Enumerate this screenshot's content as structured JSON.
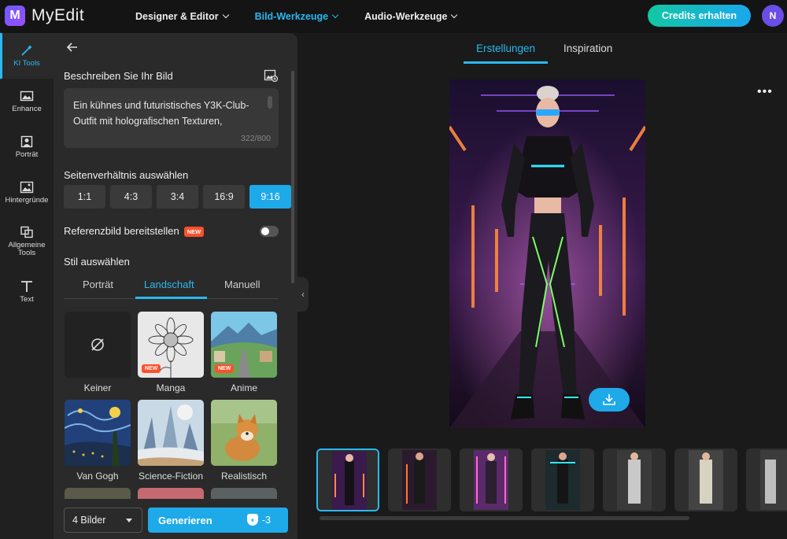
{
  "app": {
    "name": "MyEdit",
    "logo_letter": "M"
  },
  "nav": [
    {
      "label": "Designer & Editor",
      "active": false
    },
    {
      "label": "Bild-Werkzeuge",
      "active": true
    },
    {
      "label": "Audio-Werkzeuge",
      "active": false
    }
  ],
  "header": {
    "credits_label": "Credits erhalten",
    "avatar_initial": "N"
  },
  "rail": [
    {
      "label": "KI Tools",
      "icon": "magic-wand-icon",
      "active": true
    },
    {
      "label": "Enhance",
      "icon": "image-enhance-icon",
      "active": false
    },
    {
      "label": "Porträt",
      "icon": "portrait-icon",
      "active": false
    },
    {
      "label": "Hintergründe",
      "icon": "background-icon",
      "active": false
    },
    {
      "label": "Allgemeine Tools",
      "icon": "tools-icon",
      "active": false
    },
    {
      "label": "Text",
      "icon": "text-icon",
      "active": false
    }
  ],
  "panel": {
    "describe_label": "Beschreiben Sie Ihr Bild",
    "prompt_text": "Ein kühnes und futuristisches Y3K-Club-Outfit mit holografischen Texturen,",
    "prompt_count": "322/800",
    "ratio_label": "Seitenverhältnis auswählen",
    "ratios": [
      "1:1",
      "4:3",
      "3:4",
      "16:9",
      "9:16"
    ],
    "ratio_selected": "9:16",
    "reference_label": "Referenzbild bereitstellen",
    "new_badge": "NEW",
    "style_label": "Stil auswählen",
    "style_tabs": [
      "Porträt",
      "Landschaft",
      "Manuell"
    ],
    "style_tab_active": "Landschaft",
    "styles": [
      {
        "label": "Keiner",
        "new": false
      },
      {
        "label": "Manga",
        "new": true
      },
      {
        "label": "Anime",
        "new": true
      },
      {
        "label": "Van Gogh",
        "new": false
      },
      {
        "label": "Science-Fiction",
        "new": false
      },
      {
        "label": "Realistisch",
        "new": false
      }
    ],
    "count_value": "4 Bilder",
    "generate_label": "Generieren",
    "generate_cost": "-3"
  },
  "main": {
    "tabs": [
      "Erstellungen",
      "Inspiration"
    ],
    "tab_active": "Erstellungen",
    "more_label": "•••"
  },
  "colors": {
    "accent": "#1ea9e8",
    "badge": "#ff4f2b",
    "panel": "#2a2a2a",
    "background": "#1a1a1a"
  }
}
